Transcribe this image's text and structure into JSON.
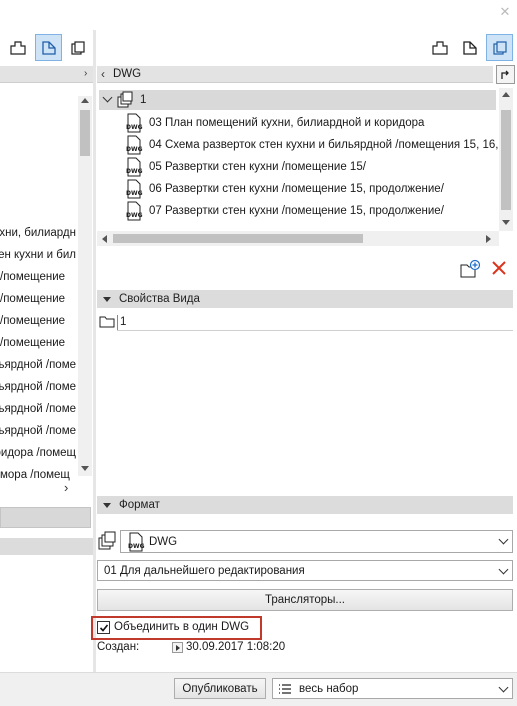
{
  "window": {
    "close_glyph": "✕"
  },
  "left_panel": {
    "rows": [
      "хни, билиардн",
      "ен кухни и бил",
      "/помещение",
      "/помещение",
      "/помещение",
      "/помещение",
      "ьярдной /поме",
      "ьярдной /поме",
      "ьярдной /поме",
      "ьярдной /поме",
      "ридора /помещ",
      "мора /помещ"
    ]
  },
  "right_panel": {
    "path_label": "DWG",
    "tree_root": "1",
    "tree_items": [
      "03 План помещений кухни, билиардной и коридора",
      "04 Схема разверток стен кухни и бильярдной /помещения 15, 16,",
      "05 Развертки стен кухни /помещение 15/",
      "06 Развертки стен кухни /помещение 15, продолжение/",
      "07 Развертки стен кухни /помещение 15, продолжение/"
    ],
    "view_props": {
      "header": "Свойства Вида",
      "folder_value": "1"
    },
    "format": {
      "header": "Формат",
      "format_value": "DWG",
      "translator_value": "01 Для дальнейшего редактирования",
      "translators_button": "Трансляторы...",
      "merge_checkbox_label": "Объединить в один DWG",
      "merge_checked": true,
      "created_label": "Создан:",
      "created_value": "30.09.2017 1:08:20"
    }
  },
  "footer": {
    "publish_button": "Опубликовать",
    "set_value": "весь набор"
  },
  "colors": {
    "accent_red": "#c0392b",
    "delete_red": "#d9341e",
    "active_blue": "#cfe3f7"
  }
}
